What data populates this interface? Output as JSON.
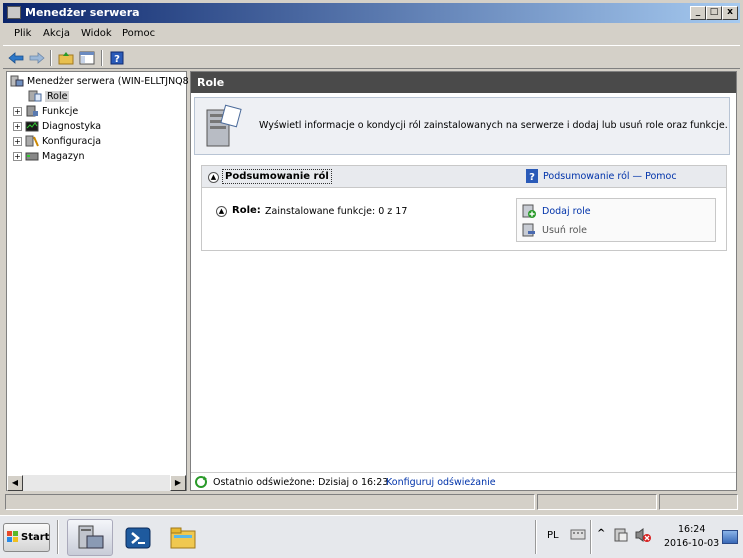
{
  "window": {
    "title": "Menedżer serwera"
  },
  "menu": [
    "Plik",
    "Akcja",
    "Widok",
    "Pomoc"
  ],
  "tree": {
    "root": "Menedżer serwera (WIN-ELLTJNQ8",
    "items": [
      "Role",
      "Funkcje",
      "Diagnostyka",
      "Konfiguracja",
      "Magazyn"
    ]
  },
  "main": {
    "header": "Role",
    "info_text": "Wyświetl informacje o kondycji ról zainstalowanych na serwerze i dodaj lub usuń role oraz funkcje.",
    "summary": {
      "title": "Podsumowanie ról",
      "help_link": "Podsumowanie ról — Pomoc",
      "role_label": "Role:",
      "role_value": "Zainstalowane funkcje: 0 z 17",
      "add_role": "Dodaj role",
      "remove_role": "Usuń role"
    },
    "footer": {
      "last_refreshed": "Ostatnio odświeżone: Dzisiaj o 16:23",
      "configure_link": "Konfiguruj odświeżanie"
    }
  },
  "taskbar": {
    "start": "Start",
    "lang": "PL",
    "time": "16:24",
    "date": "2016-10-03"
  },
  "colors": {
    "titlebar": "#0a246a",
    "link": "#0033aa",
    "header": "#4a4a4a"
  }
}
